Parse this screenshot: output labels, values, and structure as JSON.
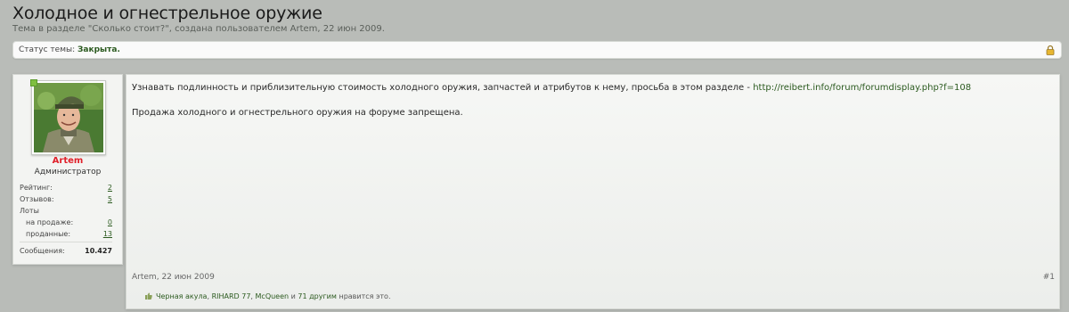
{
  "thread": {
    "title": "Холодное и огнестрельное оружие",
    "subtitle": "Тема в разделе \"Сколько стоит?\", создана пользователем Artem, 22 июн 2009."
  },
  "status": {
    "label": "Статус темы:",
    "value": "Закрыта.",
    "icon": "lock-icon"
  },
  "user": {
    "name": "Artem",
    "title": "Администратор",
    "stats": {
      "rating_label": "Рейтинг:",
      "rating": "2",
      "reviews_label": "Отзывов:",
      "reviews": "5",
      "lots_label": "Лоты",
      "on_sale_label": "на продаже:",
      "on_sale": "0",
      "sold_label": "проданные:",
      "sold": "13",
      "messages_label": "Сообщения:",
      "messages": "10.427"
    }
  },
  "post": {
    "line1_text": "Узнавать подлинность и приблизительную стоимость холодного оружия, запчастей и атрибутов к нему, просьба в этом разделе - ",
    "line1_link": "http://reibert.info/forum/forumdisplay.php?f=108",
    "line2_text": "Продажа холодного и огнестрельного оружия на форуме запрещена.",
    "author": "Artem",
    "date": "22 июн 2009",
    "number": "#1"
  },
  "likes": {
    "users": [
      "Черная акула",
      "RIHARD 77",
      "McQueen"
    ],
    "others": "71 другим",
    "and": "и",
    "suffix": "нравится это."
  },
  "colors": {
    "background": "#b9bcb8",
    "link": "#2b5a1f",
    "username": "#e0212a"
  }
}
